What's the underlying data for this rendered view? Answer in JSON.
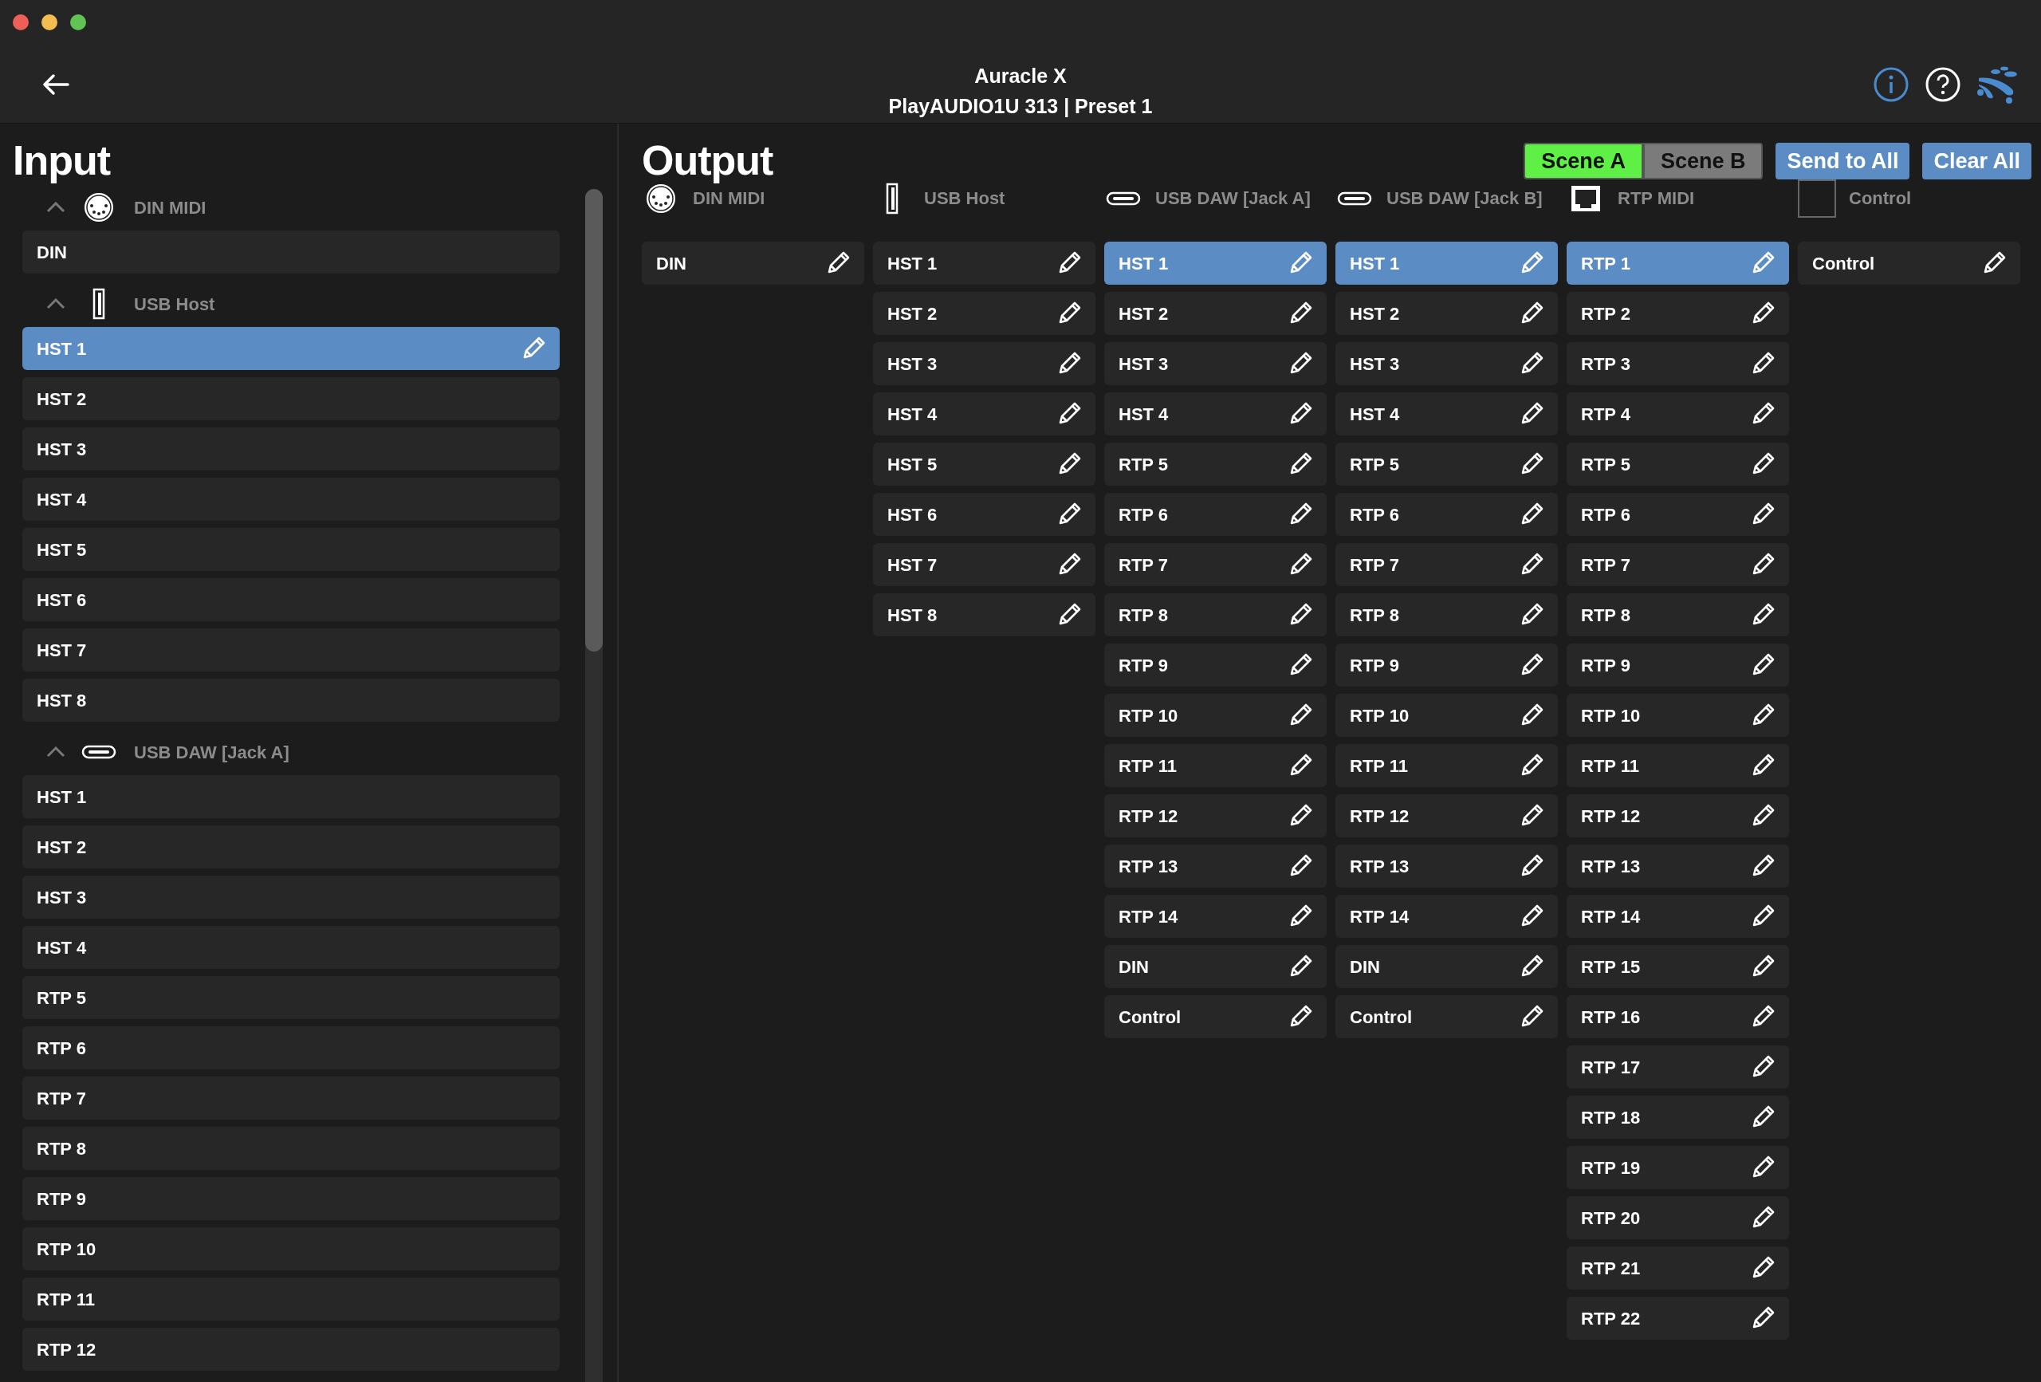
{
  "header": {
    "title": "Auracle X",
    "subtitle": "PlayAUDIO1U 313 | Preset 1"
  },
  "input": {
    "title": "Input",
    "groups": [
      {
        "kind": "din",
        "label": "DIN MIDI",
        "expanded": true,
        "items": [
          {
            "label": "DIN",
            "selected": false
          }
        ]
      },
      {
        "kind": "usb-a",
        "label": "USB Host",
        "expanded": true,
        "items": [
          {
            "label": "HST 1",
            "selected": true
          },
          {
            "label": "HST 2",
            "selected": false
          },
          {
            "label": "HST 3",
            "selected": false
          },
          {
            "label": "HST 4",
            "selected": false
          },
          {
            "label": "HST 5",
            "selected": false
          },
          {
            "label": "HST 6",
            "selected": false
          },
          {
            "label": "HST 7",
            "selected": false
          },
          {
            "label": "HST 8",
            "selected": false
          }
        ]
      },
      {
        "kind": "usb-c",
        "label": "USB DAW [Jack A]",
        "expanded": true,
        "items": [
          {
            "label": "HST 1",
            "selected": false
          },
          {
            "label": "HST 2",
            "selected": false
          },
          {
            "label": "HST 3",
            "selected": false
          },
          {
            "label": "HST 4",
            "selected": false
          },
          {
            "label": "RTP 5",
            "selected": false
          },
          {
            "label": "RTP 6",
            "selected": false
          },
          {
            "label": "RTP 7",
            "selected": false
          },
          {
            "label": "RTP 8",
            "selected": false
          },
          {
            "label": "RTP 9",
            "selected": false
          },
          {
            "label": "RTP 10",
            "selected": false
          },
          {
            "label": "RTP 11",
            "selected": false
          },
          {
            "label": "RTP 12",
            "selected": false
          }
        ]
      }
    ]
  },
  "output": {
    "title": "Output",
    "scenes": [
      {
        "label": "Scene A",
        "selected": true
      },
      {
        "label": "Scene B",
        "selected": false
      }
    ],
    "buttons": [
      "Send to All",
      "Clear All"
    ],
    "columns": [
      {
        "kind": "din",
        "label": "DIN MIDI",
        "items": [
          {
            "label": "DIN",
            "selected": false
          }
        ]
      },
      {
        "kind": "usb-a",
        "label": "USB Host",
        "items": [
          {
            "label": "HST 1",
            "selected": false
          },
          {
            "label": "HST 2",
            "selected": false
          },
          {
            "label": "HST 3",
            "selected": false
          },
          {
            "label": "HST 4",
            "selected": false
          },
          {
            "label": "HST 5",
            "selected": false
          },
          {
            "label": "HST 6",
            "selected": false
          },
          {
            "label": "HST 7",
            "selected": false
          },
          {
            "label": "HST 8",
            "selected": false
          }
        ]
      },
      {
        "kind": "usb-c",
        "label": "USB DAW [Jack A]",
        "items": [
          {
            "label": "HST 1",
            "selected": true
          },
          {
            "label": "HST 2",
            "selected": false
          },
          {
            "label": "HST 3",
            "selected": false
          },
          {
            "label": "HST 4",
            "selected": false
          },
          {
            "label": "RTP 5",
            "selected": false
          },
          {
            "label": "RTP 6",
            "selected": false
          },
          {
            "label": "RTP 7",
            "selected": false
          },
          {
            "label": "RTP 8",
            "selected": false
          },
          {
            "label": "RTP 9",
            "selected": false
          },
          {
            "label": "RTP 10",
            "selected": false
          },
          {
            "label": "RTP 11",
            "selected": false
          },
          {
            "label": "RTP 12",
            "selected": false
          },
          {
            "label": "RTP 13",
            "selected": false
          },
          {
            "label": "RTP 14",
            "selected": false
          },
          {
            "label": "DIN",
            "selected": false
          },
          {
            "label": "Control",
            "selected": false
          }
        ]
      },
      {
        "kind": "usb-c",
        "label": "USB DAW [Jack B]",
        "items": [
          {
            "label": "HST 1",
            "selected": true
          },
          {
            "label": "HST 2",
            "selected": false
          },
          {
            "label": "HST 3",
            "selected": false
          },
          {
            "label": "HST 4",
            "selected": false
          },
          {
            "label": "RTP 5",
            "selected": false
          },
          {
            "label": "RTP 6",
            "selected": false
          },
          {
            "label": "RTP 7",
            "selected": false
          },
          {
            "label": "RTP 8",
            "selected": false
          },
          {
            "label": "RTP 9",
            "selected": false
          },
          {
            "label": "RTP 10",
            "selected": false
          },
          {
            "label": "RTP 11",
            "selected": false
          },
          {
            "label": "RTP 12",
            "selected": false
          },
          {
            "label": "RTP 13",
            "selected": false
          },
          {
            "label": "RTP 14",
            "selected": false
          },
          {
            "label": "DIN",
            "selected": false
          },
          {
            "label": "Control",
            "selected": false
          }
        ]
      },
      {
        "kind": "rtp",
        "label": "RTP MIDI",
        "items": [
          {
            "label": "RTP 1",
            "selected": true
          },
          {
            "label": "RTP 2",
            "selected": false
          },
          {
            "label": "RTP 3",
            "selected": false
          },
          {
            "label": "RTP 4",
            "selected": false
          },
          {
            "label": "RTP 5",
            "selected": false
          },
          {
            "label": "RTP 6",
            "selected": false
          },
          {
            "label": "RTP 7",
            "selected": false
          },
          {
            "label": "RTP 8",
            "selected": false
          },
          {
            "label": "RTP 9",
            "selected": false
          },
          {
            "label": "RTP 10",
            "selected": false
          },
          {
            "label": "RTP 11",
            "selected": false
          },
          {
            "label": "RTP 12",
            "selected": false
          },
          {
            "label": "RTP 13",
            "selected": false
          },
          {
            "label": "RTP 14",
            "selected": false
          },
          {
            "label": "RTP 15",
            "selected": false
          },
          {
            "label": "RTP 16",
            "selected": false
          },
          {
            "label": "RTP 17",
            "selected": false
          },
          {
            "label": "RTP 18",
            "selected": false
          },
          {
            "label": "RTP 19",
            "selected": false
          },
          {
            "label": "RTP 20",
            "selected": false
          },
          {
            "label": "RTP 21",
            "selected": false
          },
          {
            "label": "RTP 22",
            "selected": false
          }
        ]
      },
      {
        "kind": "control",
        "label": "Control",
        "items": [
          {
            "label": "Control",
            "selected": false
          }
        ]
      }
    ]
  }
}
